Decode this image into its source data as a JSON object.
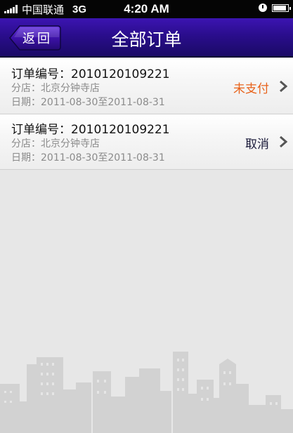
{
  "status_bar": {
    "carrier": "中国联通",
    "network": "3G",
    "time": "4:20 AM",
    "signal_icon": "signal-bars-icon",
    "alarm_icon": "clock-icon",
    "battery_icon": "battery-icon",
    "battery_level": 0.9
  },
  "nav": {
    "back_label": "返回",
    "title": "全部订单",
    "color": "#2a0d8c"
  },
  "orders": [
    {
      "id_text": "订单编号：2010120109221",
      "store_text": "分店：北京分钟寺店",
      "date_text": "日期：2011-08-30至2011-08-31",
      "status": "未支付",
      "status_color": "#e8621a"
    },
    {
      "id_text": "订单编号：2010120109221",
      "store_text": "分店：北京分钟寺店",
      "date_text": "日期：2011-08-30至2011-08-31",
      "status": "取消",
      "status_color": "#1a1a3a"
    }
  ]
}
